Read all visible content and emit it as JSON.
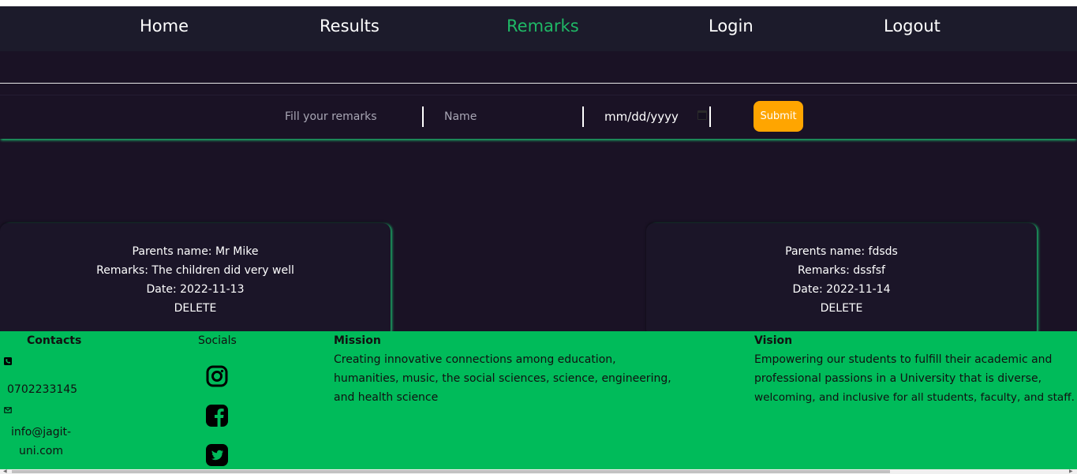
{
  "nav": {
    "home": "Home",
    "results": "Results",
    "remarks": "Remarks",
    "login": "Login",
    "logout": "Logout"
  },
  "form": {
    "remarks_placeholder": "Fill your remarks",
    "name_placeholder": "Name",
    "date_placeholder": "mm/dd/yyyy",
    "submit_label": "Submit"
  },
  "cards": [
    {
      "parent": "Parents name: Mr Mike",
      "remarks": "Remarks: The children did very well",
      "date": "Date: 2022-11-13",
      "delete": "DELETE"
    },
    {
      "parent": "Parents name: fdsds",
      "remarks": "Remarks: dssfsf",
      "date": "Date: 2022-11-14",
      "delete": "DELETE"
    }
  ],
  "footer": {
    "contacts_title": "Contacts",
    "phone": "0702233145",
    "email_line1": "info@jagit-",
    "email_line2": "uni.com",
    "socials_title": "Socials",
    "mission_title": "Mission",
    "mission_lines": [
      "Creating innovative connections among education,",
      "humanities, music, the social sciences, science, engineering,",
      "and health science"
    ],
    "vision_title": "Vision",
    "vision_lines": [
      "Empowering our students to fulfill their academic and",
      "professional passions in a University that is diverse,",
      "welcoming, and inclusive for all students, faculty, and staff."
    ]
  },
  "icons": {
    "phone": "phone-icon",
    "email": "envelope-icon",
    "instagram": "instagram-icon",
    "facebook": "facebook-icon",
    "twitter": "twitter-icon",
    "calendar": "calendar-icon"
  },
  "colors": {
    "active_nav": "#1fb866",
    "submit": "#ffa500",
    "footer_bg": "#00bb5a",
    "page_bg": "#1a1225"
  }
}
